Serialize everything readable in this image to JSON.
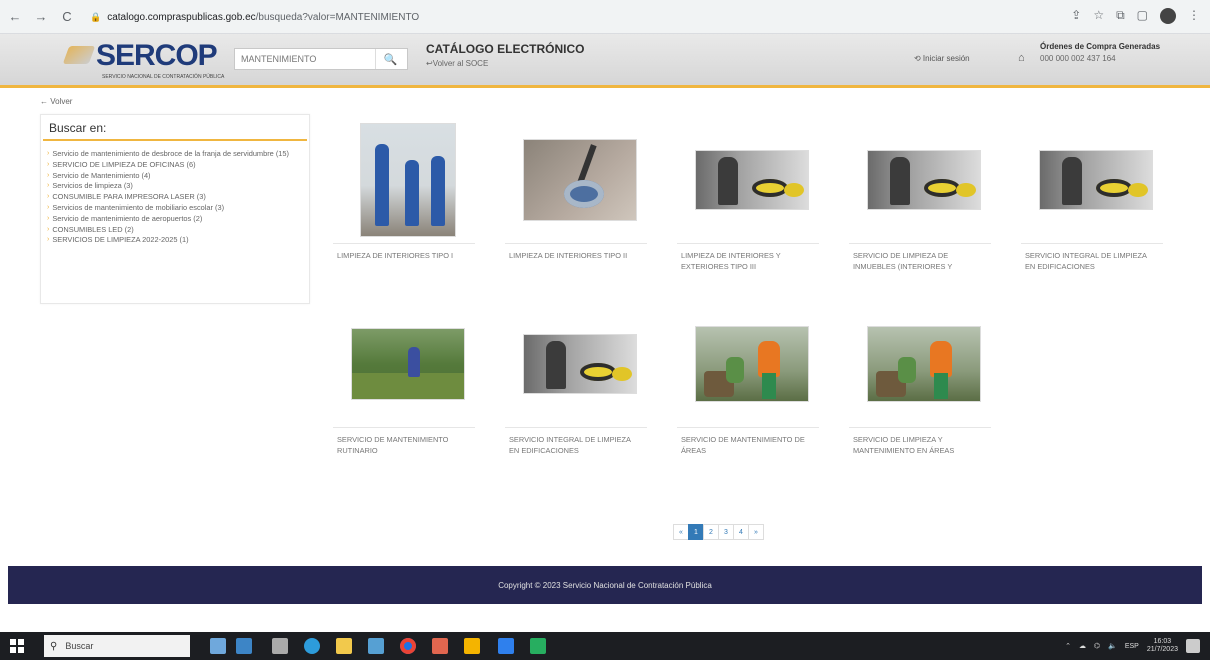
{
  "browser": {
    "url_host": "catalogo.compraspublicas.gob.ec",
    "url_path": "/busqueda?valor=MANTENIMIENTO",
    "back": "←",
    "forward": "→",
    "reload": "C"
  },
  "header": {
    "logo_text": "SERCOP",
    "logo_subtitle": "SERVICIO NACIONAL DE CONTRATACIÓN PÚBLICA",
    "search_value": "MANTENIMIENTO",
    "catalog_title": "CATÁLOGO ELECTRÓNICO",
    "back_soce": "↩Volver al SOCE",
    "login": "⟲ Iniciar sesión",
    "orders_title": "Órdenes de Compra Generadas",
    "orders_count": "000 000 002 437 164"
  },
  "sidebar": {
    "back": "← Volver",
    "title": "Buscar en:",
    "items": [
      "Servicio de mantenimiento de desbroce de la franja de servidumbre (15)",
      "SERVICIO DE LIMPIEZA DE OFICINAS (6)",
      "Servicio de Mantenimiento (4)",
      "Servicios de limpieza (3)",
      "CONSUMIBLE PARA IMPRESORA LASER (3)",
      "Servicios de mantenimiento de mobiliario escolar (3)",
      "Servicio de mantenimiento de aeropuertos (2)",
      "CONSUMIBLES LED (2)",
      "SERVICIOS DE LIMPIEZA 2022-2025 (1)"
    ]
  },
  "products": [
    {
      "name": "LIMPIEZA DE INTERIORES TIPO I",
      "image": "workers"
    },
    {
      "name": "LIMPIEZA DE INTERIORES TIPO II",
      "image": "floor"
    },
    {
      "name": "LIMPIEZA DE INTERIORES Y EXTERIORES TIPO III",
      "image": "vacuum"
    },
    {
      "name": "SERVICIO DE LIMPIEZA DE INMUEBLES (INTERIORES Y",
      "image": "vacuum"
    },
    {
      "name": "SERVICIO INTEGRAL DE LIMPIEZA EN EDIFICACIONES",
      "image": "vacuum"
    },
    {
      "name": "SERVICIO DE MANTENIMIENTO RUTINARIO",
      "image": "park"
    },
    {
      "name": "SERVICIO INTEGRAL DE LIMPIEZA EN EDIFICACIONES",
      "image": "vacuum"
    },
    {
      "name": "SERVICIO DE MANTENIMIENTO DE ÁREAS",
      "image": "garden"
    },
    {
      "name": "SERVICIO DE LIMPIEZA Y MANTENIMIENTO EN ÁREAS",
      "image": "garden"
    }
  ],
  "pagination": {
    "prev": "«",
    "pages": [
      "1",
      "2",
      "3",
      "4"
    ],
    "active": "1",
    "next": "»"
  },
  "footer": {
    "copyright": "Copyright © 2023 Servicio Nacional de Contratación Pública"
  },
  "taskbar": {
    "search_placeholder": "Buscar",
    "time": "16:03",
    "date": "21/7/2023",
    "lang": "ESP"
  },
  "colors": {
    "accent": "#f0b640",
    "brand": "#1f3b7a",
    "footer": "#252651",
    "link": "#337ab7"
  }
}
